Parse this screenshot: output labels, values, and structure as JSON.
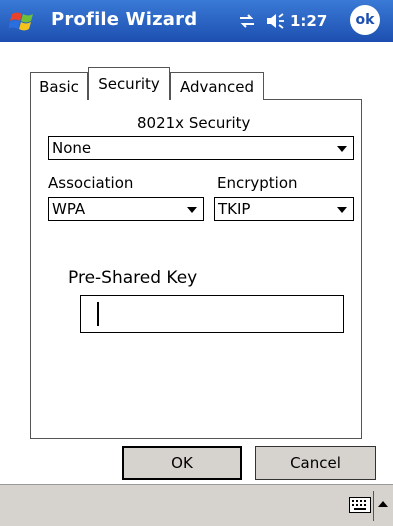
{
  "titlebar": {
    "title": "Profile Wizard",
    "time": "1:27",
    "ok_label": "ok"
  },
  "tabs": [
    {
      "label": "Basic",
      "active": false
    },
    {
      "label": "Security",
      "active": true
    },
    {
      "label": "Advanced",
      "active": false
    }
  ],
  "security": {
    "section_label": "8021x Security",
    "security_value": "None",
    "association_label": "Association",
    "association_value": "WPA",
    "encryption_label": "Encryption",
    "encryption_value": "TKIP",
    "psk_label": "Pre-Shared Key",
    "psk_value": ""
  },
  "buttons": {
    "ok_label": "OK",
    "cancel_label": "Cancel"
  },
  "colors": {
    "titlebar": "#1d4fb0",
    "menubar": "#d6d3ce"
  },
  "icons": {
    "start": "windows-flag-icon",
    "connectivity": "connectivity-icon",
    "volume": "speaker-icon",
    "keyboard": "keyboard-icon"
  }
}
